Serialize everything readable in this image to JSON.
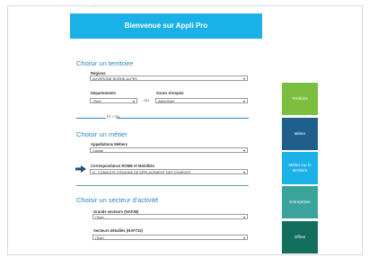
{
  "header": {
    "title": "Bienvenue sur Appli Pro"
  },
  "territoire": {
    "title": "Choisir un territoire",
    "regions_label": "Régions",
    "regions_value": "AUVERGNE-RHÔNE-ALPES",
    "departements_label": "Départements",
    "departements_value": "(Tout)",
    "ou": "OU",
    "zones_label": "Zones d'emploi",
    "zones_value": "ANNONAY",
    "et_ou": "ET / OU"
  },
  "metier": {
    "title": "Choisir un métier",
    "appellations_label": "Appellations Métiers",
    "appellations_value": "Cariste",
    "correspondance_label": "Correspondance ROME et Mobilités",
    "correspondance_value": "N - CONDUITE D'ENGINS DE DÉPLACEMENT DES CHARGES"
  },
  "secteur": {
    "title": "Choisir un secteur d'activité",
    "grands_label": "Grands secteurs (NAF38)",
    "grands_value": "(Tout)",
    "detailles_label": "Secteurs détaillés (NAF732)",
    "detailles_value": "(Tout)"
  },
  "tiles": [
    {
      "label": "Territoire",
      "color": "#7cbf3f"
    },
    {
      "label": "Métier",
      "color": "#1f5f8b"
    },
    {
      "label": "Métier sur le territoire",
      "color": "#1ab1e8"
    },
    {
      "label": "Entreprises",
      "color": "#3aa39a"
    },
    {
      "label": "Offres",
      "color": "#146e5e"
    }
  ]
}
